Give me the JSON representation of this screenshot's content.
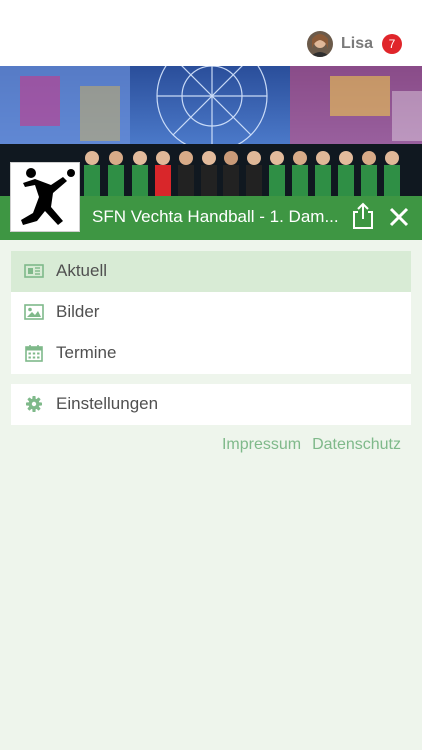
{
  "user": {
    "name": "Lisa",
    "notification_count": "7"
  },
  "team": {
    "title": "SFN Vechta Handball - 1. Dam..."
  },
  "menu": {
    "main_items": [
      {
        "label": "Aktuell",
        "icon": "newspaper-icon",
        "active": true
      },
      {
        "label": "Bilder",
        "icon": "image-icon",
        "active": false
      },
      {
        "label": "Termine",
        "icon": "calendar-icon",
        "active": false
      }
    ],
    "settings_item": {
      "label": "Einstellungen",
      "icon": "gear-icon"
    }
  },
  "footer_links": {
    "impressum": "Impressum",
    "datenschutz": "Datenschutz"
  },
  "colors": {
    "brand_green": "#3e9643",
    "active_row": "#d8ebd5",
    "badge_red": "#e0252a",
    "link_green": "#7fb98a",
    "background": "#eef5ec"
  }
}
